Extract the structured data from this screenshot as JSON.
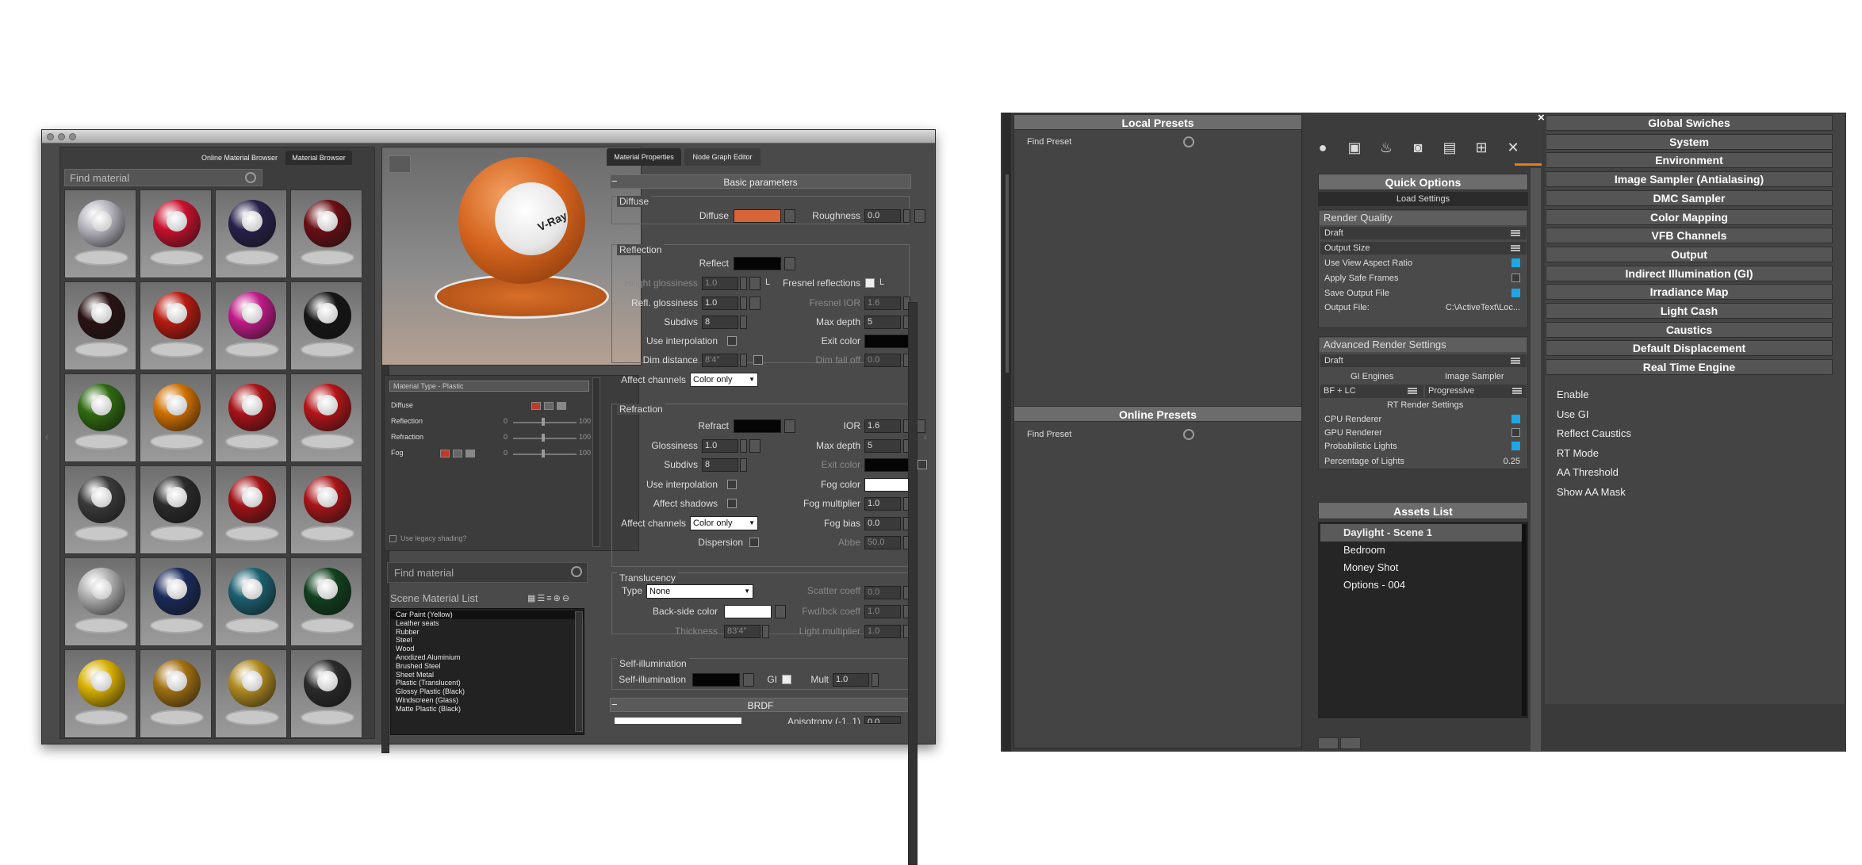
{
  "browser": {
    "tab_online": "Online Material Browser",
    "tab_material": "Material Browser",
    "find_placeholder": "Find material"
  },
  "swatch_colors": [
    "#b8b6c0",
    "#c8102e",
    "#28204a",
    "#6a0e14",
    "#2a1214",
    "#b81a10",
    "#c01a88",
    "#151515",
    "#2e6a10",
    "#d07000",
    "#a81218",
    "#b41418",
    "#3a3a3a",
    "#2a2a2a",
    "#a01216",
    "#a81418",
    "#b0b0b0",
    "#1a2a5a",
    "#1c6070",
    "#10401e",
    "#d8b000",
    "#a07010",
    "#b08a20",
    "#2a2a2a"
  ],
  "preview": {
    "vray_text": "V-Ray",
    "sphere_color": "#d4641e"
  },
  "material_panel": {
    "type_label": "Material Type - Plastic",
    "rows": [
      "Diffuse",
      "Reflection",
      "Refraction",
      "Fog"
    ],
    "slider_min": "0",
    "slider_max": "100",
    "legacy": "Use legacy shading?"
  },
  "scene": {
    "find_placeholder": "Find material",
    "list_title": "Scene Material List",
    "items": [
      "Car Paint (Yellow)",
      "Leather seats",
      "Rubber",
      "Steel",
      "Wood",
      "Anodized Aluminium",
      "Brushed Steel",
      "Sheet Metal",
      "Plastic (Translucent)",
      "Glossy Plastic (Black)",
      "Windscreen (Glass)",
      "Matte Plastic (Black)"
    ]
  },
  "props": {
    "tab_props": "Material Properties",
    "tab_node": "Node Graph Editor",
    "basic_header": "Basic parameters",
    "diffuse": {
      "title": "Diffuse",
      "diffuse": "Diffuse",
      "roughness": "Roughness",
      "roughness_val": "0.0",
      "color": "#d8643a"
    },
    "reflection": {
      "title": "Reflection",
      "reflect": "Reflect",
      "hilight": "Hilight glossiness",
      "hilight_val": "1.0",
      "fresnel": "Fresnel reflections",
      "fresnel_lock": "L",
      "hilight_lock": "L",
      "refl_gloss": "Refl. glossiness",
      "refl_gloss_val": "1.0",
      "fresnel_ior": "Fresnel IOR",
      "fresnel_ior_val": "1.6",
      "subdivs": "Subdivs",
      "subdivs_val": "8",
      "max_depth": "Max depth",
      "max_depth_val": "5",
      "use_interp": "Use interpolation",
      "exit_color": "Exit color",
      "dim_distance": "Dim distance",
      "dim_distance_val": "8'4\"",
      "dim_falloff": "Dim fall off",
      "dim_falloff_val": "0.0",
      "affect_channels": "Affect channels",
      "affect_channels_val": "Color only"
    },
    "refraction": {
      "title": "Refraction",
      "refract": "Refract",
      "ior": "IOR",
      "ior_val": "1.6",
      "glossiness": "Glossiness",
      "glossiness_val": "1.0",
      "max_depth": "Max depth",
      "max_depth_val": "5",
      "subdivs": "Subdivs",
      "subdivs_val": "8",
      "exit_color": "Exit color",
      "use_interp": "Use interpolation",
      "fog_color": "Fog color",
      "affect_shadows": "Affect shadows",
      "fog_mult": "Fog multiplier",
      "fog_mult_val": "1.0",
      "affect_channels": "Affect channels",
      "affect_channels_val": "Color only",
      "fog_bias": "Fog bias",
      "fog_bias_val": "0.0",
      "dispersion": "Dispersion",
      "abbe": "Abbe",
      "abbe_val": "50.0"
    },
    "translucency": {
      "title": "Translucency",
      "type": "Type",
      "type_val": "None",
      "scatter": "Scatter coeff",
      "scatter_val": "0.0",
      "backside": "Back-side color",
      "fwd": "Fwd/bck coeff",
      "fwd_val": "1.0",
      "thickness": "Thickness",
      "thickness_val": "83'4\"",
      "light_mult": "Light multiplier",
      "light_mult_val": "1.0"
    },
    "selfillum": {
      "title": "Self-illumination",
      "label": "Self-illumination",
      "gi": "GI",
      "mult": "Mult",
      "mult_val": "1.0"
    },
    "brdf_header": "BRDF",
    "anisotropy": "Anisotropy (-1..1)",
    "anisotropy_val": "0.0"
  },
  "right": {
    "close": "×",
    "local_presets": "Local Presets",
    "find_preset": "Find Preset",
    "online_presets": "Online Presets",
    "find_preset2": "Find Preset",
    "tab_icons": [
      "sphere-icon",
      "image-icon",
      "bulb-icon",
      "camera-icon",
      "document-icon",
      "network-icon",
      "tools-icon"
    ],
    "quick_options": "Quick Options",
    "load_settings": "Load Settings",
    "render_quality": "Render Quality",
    "rq_rows": [
      {
        "label": "Draft",
        "state": "menu"
      },
      {
        "label": "Output Size",
        "state": "menu"
      },
      {
        "label": "Use View Aspect Ratio",
        "state": "on"
      },
      {
        "label": "Apply Safe Frames",
        "state": "off"
      },
      {
        "label": "Save Output File",
        "state": "on"
      }
    ],
    "output_file_label": "Output File:",
    "output_file_val": "C:\\ActiveText\\Loc...",
    "advanced": "Advanced Render Settings",
    "adv_draft": "Draft",
    "gi_engines": "GI Engines",
    "image_sampler": "Image Sampler",
    "gi_val": "BF + LC",
    "sampler_val": "Progressive",
    "rt_settings": "RT Render Settings",
    "rt_rows": [
      {
        "label": "CPU Renderer",
        "state": "on"
      },
      {
        "label": "GPU Renderer",
        "state": "off"
      },
      {
        "label": "Probabilistic Lights",
        "state": "on"
      }
    ],
    "lights_pct_label": "Percentage of Lights",
    "lights_pct_val": "0.25",
    "assets_list": "Assets List",
    "assets": [
      "Daylight - Scene 1",
      "Bedroom",
      "Money Shot",
      "Options - 004"
    ],
    "global_switches": [
      "Global Swiches",
      "System",
      "Environment",
      "Image Sampler (Antialasing)",
      "DMC Sampler",
      "Color Mapping",
      "VFB Channels",
      "Output",
      "Indirect Illumination (GI)",
      "Irradiance Map",
      "Light Cash",
      "Caustics",
      "Default Displacement",
      "Real Time Engine"
    ],
    "rte_items": [
      "Enable",
      "Use GI",
      "Reflect Caustics",
      "RT Mode",
      "AA Threshold",
      "Show AA Mask"
    ]
  }
}
